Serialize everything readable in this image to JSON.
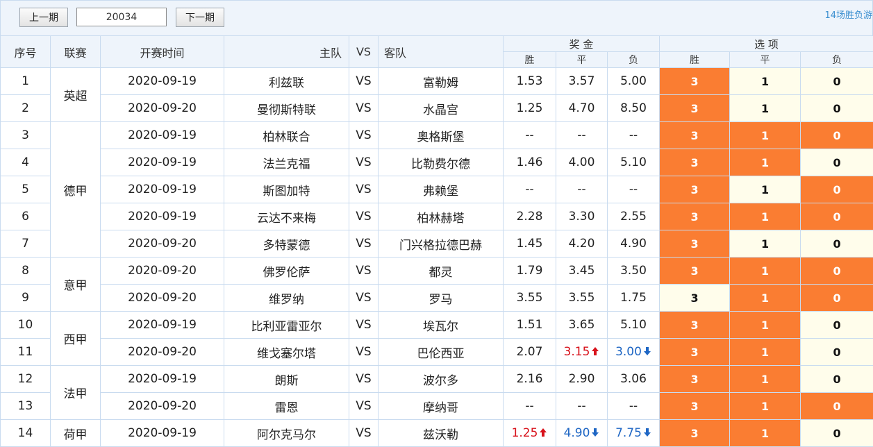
{
  "toolbar": {
    "prev_label": "上一期",
    "issue_value": "20034",
    "next_label": "下一期",
    "right_link": "14场胜负游"
  },
  "headers": {
    "index": "序号",
    "league": "联赛",
    "time": "开赛时间",
    "home": "主队",
    "vs": "VS",
    "away": "客队",
    "prize": "奖 金",
    "options": "选 项",
    "win": "胜",
    "draw": "平",
    "lose": "负"
  },
  "colors": {
    "selected_bg": "#fa7d32",
    "unselected_bg": "#fffdeb",
    "up_arrow": "#d8121b",
    "down_arrow": "#1e66c4"
  },
  "leagues": [
    {
      "name": "英超",
      "rows": 2
    },
    {
      "name": "德甲",
      "rows": 5
    },
    {
      "name": "意甲",
      "rows": 2
    },
    {
      "name": "西甲",
      "rows": 2
    },
    {
      "name": "法甲",
      "rows": 2
    },
    {
      "name": "荷甲",
      "rows": 1
    }
  ],
  "matches": [
    {
      "no": "1",
      "date": "2020-09-19",
      "home": "利兹联",
      "vs": "VS",
      "away": "富勒姆",
      "odds": [
        {
          "v": "1.53",
          "t": ""
        },
        {
          "v": "3.57",
          "t": ""
        },
        {
          "v": "5.00",
          "t": ""
        }
      ],
      "picks": [
        {
          "v": "3",
          "on": true
        },
        {
          "v": "1",
          "on": false
        },
        {
          "v": "0",
          "on": false
        }
      ]
    },
    {
      "no": "2",
      "date": "2020-09-20",
      "home": "曼彻斯特联",
      "vs": "VS",
      "away": "水晶宫",
      "odds": [
        {
          "v": "1.25",
          "t": ""
        },
        {
          "v": "4.70",
          "t": ""
        },
        {
          "v": "8.50",
          "t": ""
        }
      ],
      "picks": [
        {
          "v": "3",
          "on": true
        },
        {
          "v": "1",
          "on": false
        },
        {
          "v": "0",
          "on": false
        }
      ]
    },
    {
      "no": "3",
      "date": "2020-09-19",
      "home": "柏林联合",
      "vs": "VS",
      "away": "奥格斯堡",
      "odds": [
        {
          "v": "--",
          "t": ""
        },
        {
          "v": "--",
          "t": ""
        },
        {
          "v": "--",
          "t": ""
        }
      ],
      "picks": [
        {
          "v": "3",
          "on": true
        },
        {
          "v": "1",
          "on": true
        },
        {
          "v": "0",
          "on": true
        }
      ]
    },
    {
      "no": "4",
      "date": "2020-09-19",
      "home": "法兰克福",
      "vs": "VS",
      "away": "比勒费尔德",
      "odds": [
        {
          "v": "1.46",
          "t": ""
        },
        {
          "v": "4.00",
          "t": ""
        },
        {
          "v": "5.10",
          "t": ""
        }
      ],
      "picks": [
        {
          "v": "3",
          "on": true
        },
        {
          "v": "1",
          "on": true
        },
        {
          "v": "0",
          "on": false
        }
      ]
    },
    {
      "no": "5",
      "date": "2020-09-19",
      "home": "斯图加特",
      "vs": "VS",
      "away": "弗赖堡",
      "odds": [
        {
          "v": "--",
          "t": ""
        },
        {
          "v": "--",
          "t": ""
        },
        {
          "v": "--",
          "t": ""
        }
      ],
      "picks": [
        {
          "v": "3",
          "on": true
        },
        {
          "v": "1",
          "on": false
        },
        {
          "v": "0",
          "on": true
        }
      ]
    },
    {
      "no": "6",
      "date": "2020-09-19",
      "home": "云达不来梅",
      "vs": "VS",
      "away": "柏林赫塔",
      "odds": [
        {
          "v": "2.28",
          "t": ""
        },
        {
          "v": "3.30",
          "t": ""
        },
        {
          "v": "2.55",
          "t": ""
        }
      ],
      "picks": [
        {
          "v": "3",
          "on": true
        },
        {
          "v": "1",
          "on": true
        },
        {
          "v": "0",
          "on": true
        }
      ]
    },
    {
      "no": "7",
      "date": "2020-09-20",
      "home": "多特蒙德",
      "vs": "VS",
      "away": "门兴格拉德巴赫",
      "odds": [
        {
          "v": "1.45",
          "t": ""
        },
        {
          "v": "4.20",
          "t": ""
        },
        {
          "v": "4.90",
          "t": ""
        }
      ],
      "picks": [
        {
          "v": "3",
          "on": true
        },
        {
          "v": "1",
          "on": false
        },
        {
          "v": "0",
          "on": false
        }
      ]
    },
    {
      "no": "8",
      "date": "2020-09-20",
      "home": "佛罗伦萨",
      "vs": "VS",
      "away": "都灵",
      "odds": [
        {
          "v": "1.79",
          "t": ""
        },
        {
          "v": "3.45",
          "t": ""
        },
        {
          "v": "3.50",
          "t": ""
        }
      ],
      "picks": [
        {
          "v": "3",
          "on": true
        },
        {
          "v": "1",
          "on": true
        },
        {
          "v": "0",
          "on": true
        }
      ]
    },
    {
      "no": "9",
      "date": "2020-09-20",
      "home": "维罗纳",
      "vs": "VS",
      "away": "罗马",
      "odds": [
        {
          "v": "3.55",
          "t": ""
        },
        {
          "v": "3.55",
          "t": ""
        },
        {
          "v": "1.75",
          "t": ""
        }
      ],
      "picks": [
        {
          "v": "3",
          "on": false
        },
        {
          "v": "1",
          "on": true
        },
        {
          "v": "0",
          "on": true
        }
      ]
    },
    {
      "no": "10",
      "date": "2020-09-19",
      "home": "比利亚雷亚尔",
      "vs": "VS",
      "away": "埃瓦尔",
      "odds": [
        {
          "v": "1.51",
          "t": ""
        },
        {
          "v": "3.65",
          "t": ""
        },
        {
          "v": "5.10",
          "t": ""
        }
      ],
      "picks": [
        {
          "v": "3",
          "on": true
        },
        {
          "v": "1",
          "on": true
        },
        {
          "v": "0",
          "on": false
        }
      ]
    },
    {
      "no": "11",
      "date": "2020-09-20",
      "home": "维戈塞尔塔",
      "vs": "VS",
      "away": "巴伦西亚",
      "odds": [
        {
          "v": "2.07",
          "t": ""
        },
        {
          "v": "3.15",
          "t": "up"
        },
        {
          "v": "3.00",
          "t": "down"
        }
      ],
      "picks": [
        {
          "v": "3",
          "on": true
        },
        {
          "v": "1",
          "on": true
        },
        {
          "v": "0",
          "on": false
        }
      ]
    },
    {
      "no": "12",
      "date": "2020-09-19",
      "home": "朗斯",
      "vs": "VS",
      "away": "波尔多",
      "odds": [
        {
          "v": "2.16",
          "t": ""
        },
        {
          "v": "2.90",
          "t": ""
        },
        {
          "v": "3.06",
          "t": ""
        }
      ],
      "picks": [
        {
          "v": "3",
          "on": true
        },
        {
          "v": "1",
          "on": true
        },
        {
          "v": "0",
          "on": false
        }
      ]
    },
    {
      "no": "13",
      "date": "2020-09-20",
      "home": "雷恩",
      "vs": "VS",
      "away": "摩纳哥",
      "odds": [
        {
          "v": "--",
          "t": ""
        },
        {
          "v": "--",
          "t": ""
        },
        {
          "v": "--",
          "t": ""
        }
      ],
      "picks": [
        {
          "v": "3",
          "on": true
        },
        {
          "v": "1",
          "on": true
        },
        {
          "v": "0",
          "on": true
        }
      ]
    },
    {
      "no": "14",
      "date": "2020-09-19",
      "home": "阿尔克马尔",
      "vs": "VS",
      "away": "兹沃勒",
      "odds": [
        {
          "v": "1.25",
          "t": "up"
        },
        {
          "v": "4.90",
          "t": "down"
        },
        {
          "v": "7.75",
          "t": "down"
        }
      ],
      "picks": [
        {
          "v": "3",
          "on": true
        },
        {
          "v": "1",
          "on": true
        },
        {
          "v": "0",
          "on": false
        }
      ]
    }
  ]
}
